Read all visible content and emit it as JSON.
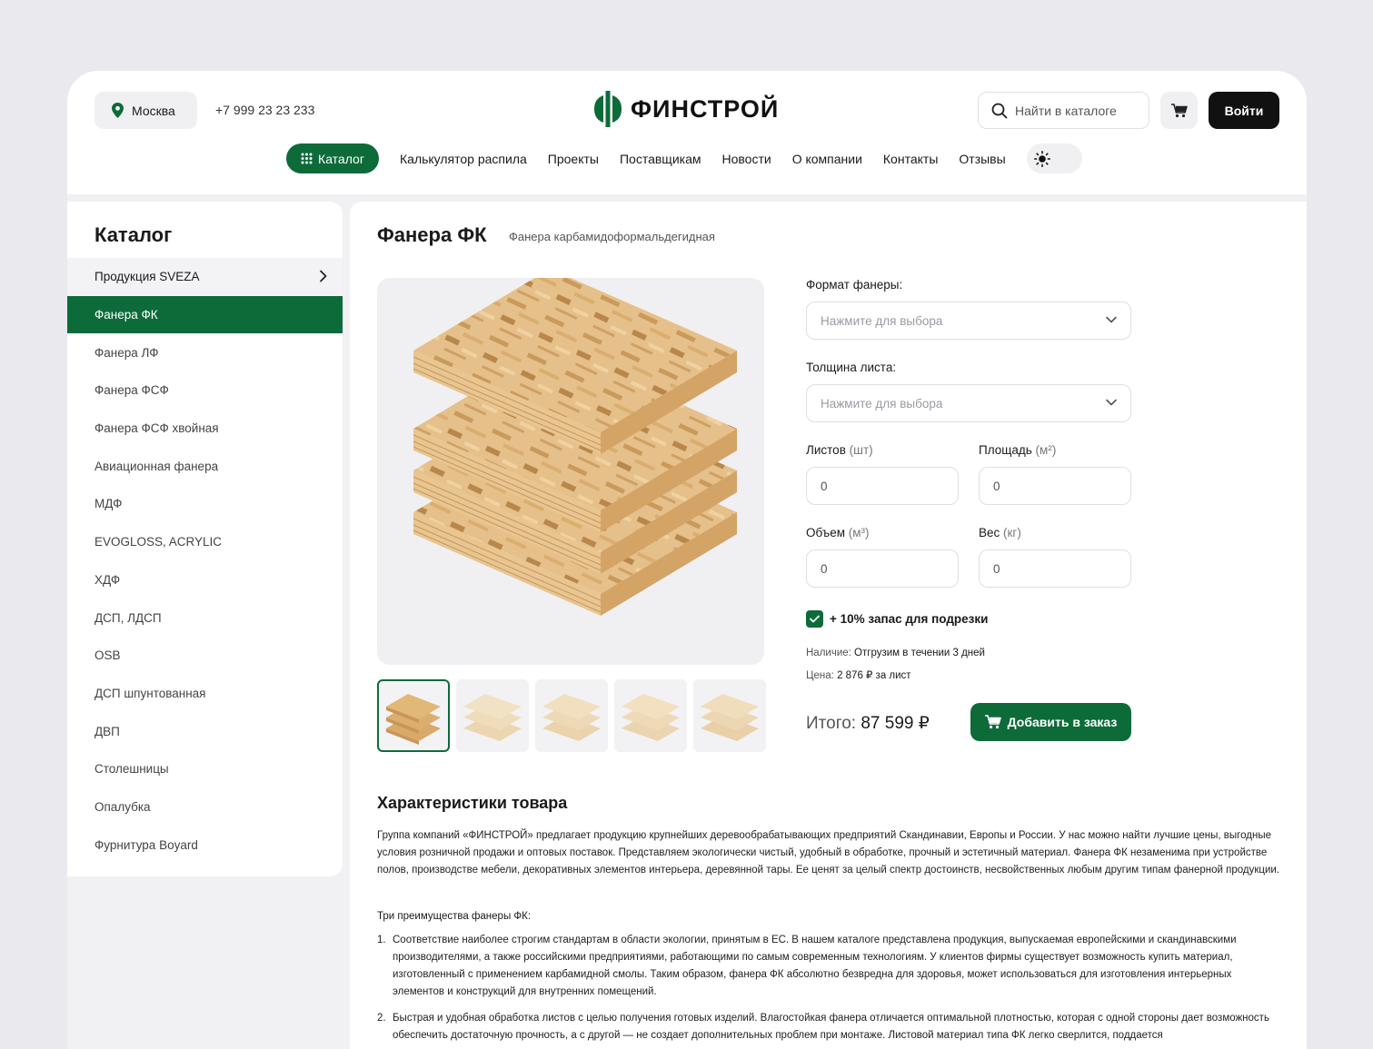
{
  "header": {
    "city": "Москва",
    "phone": "+7 999 23 23 233",
    "logo_text": "ФИНСТРОЙ",
    "search_placeholder": "Найти в каталоге",
    "login_label": "Войти",
    "brand_color": "#0d6b3a"
  },
  "nav": {
    "catalog_label": "Каталог",
    "items": [
      "Калькулятор распила",
      "Проекты",
      "Поставщикам",
      "Новости",
      "О компании",
      "Контакты",
      "Отзывы"
    ]
  },
  "sidebar": {
    "title": "Каталог",
    "items": [
      "Продукция SVEZA",
      "Фанера ФК",
      "Фанера ЛФ",
      "Фанера ФСФ",
      "Фанера ФСФ хвойная",
      "Авиационная фанера",
      "МДФ",
      "EVOGLOSS, ACRYLIC",
      "ХДФ",
      "ДСП, ЛДСП",
      "OSB",
      "ДСП шпунтованная",
      "ДВП",
      "Столешницы",
      "Опалубка",
      "Фурнитура Boyard"
    ]
  },
  "product": {
    "title": "Фанера ФК",
    "subtitle": "Фанера карбамидоформальдегидная",
    "format_label": "Формат фанеры:",
    "format_placeholder": "Нажмите для выбора",
    "thickness_label": "Толщина листа:",
    "thickness_placeholder": "Нажмите для выбора",
    "sheets_label": "Листов",
    "sheets_unit": "(шт)",
    "sheets_value": "0",
    "area_label": "Площадь",
    "area_unit": "(м²)",
    "area_value": "0",
    "volume_label": "Объем",
    "volume_unit": "(м³)",
    "volume_value": "0",
    "weight_label": "Вес",
    "weight_unit": "(кг)",
    "weight_value": "0",
    "reserve_label": "+ 10% запас для подрезки",
    "reserve_checked": true,
    "availability_key": "Наличие:",
    "availability_value": "Отгрузим в течении 3 дней",
    "price_key": "Цена:",
    "price_value": "2 876 ₽ за лист",
    "total_label": "Итого:",
    "total_value": "87 599 ₽",
    "add_button": "Добавить в заказ"
  },
  "description": {
    "title": "Характеристики товара",
    "text": "Группа компаний «ФИНСТРОЙ» предлагает продукцию крупнейших деревообрабатывающих предприятий Скандинавии, Европы и России. У нас можно найти лучшие цены, выгодные условия розничной продажи и оптовых поставок. Представляем экологически чистый, удобный в обработке, прочный и эстетичный материал. Фанера ФК незаменима при устройстве полов, производстве мебели, декоративных элементов интерьера, деревянной тары. Ее ценят за целый спектр достоинств, несвойственных любым другим типам фанерной продукции.",
    "advantages_title": "Три преимущества фанеры ФК:",
    "advantages": [
      "Соответствие наиболее строгим стандартам в области экологии, принятым в ЕС. В нашем каталоге представлена продукция, выпускаемая европейскими и скандинавскими производителями, а также российскими предприятиями, работающими по самым современным технологиям. У клиентов фирмы существует возможность купить материал, изготовленный с применением карбамидной смолы. Таким образом, фанера ФК абсолютно безвредна для здоровья, может использоваться для изготовления интерьерных элементов и конструкций для внутренних помещений.",
      "Быстрая и удобная обработка листов с целью получения готовых изделий. Влагостойкая фанера отличается оптимальной плотностью, которая с одной стороны дает возможность обеспечить достаточную прочность, а с другой — не создает дополнительных проблем при монтаже. Листовой материал типа ФК легко сверлится, поддается"
    ]
  }
}
